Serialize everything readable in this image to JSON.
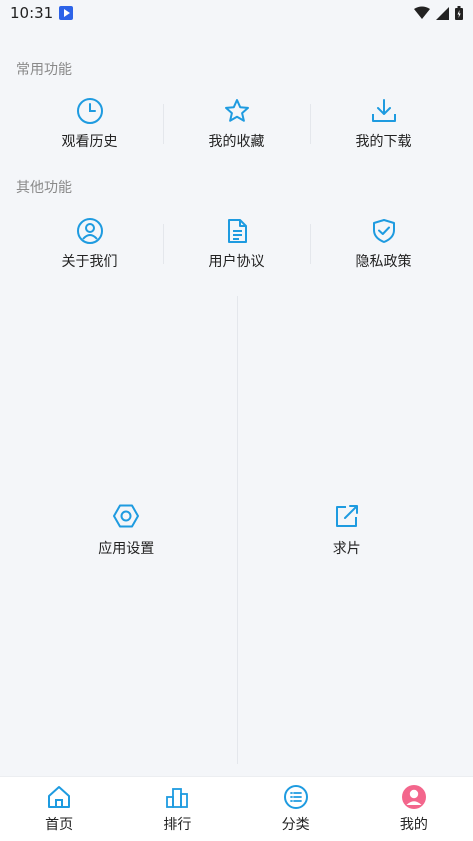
{
  "status_bar": {
    "time": "10:31",
    "icons": [
      "app-notification-icon",
      "wifi-icon",
      "signal-icon",
      "battery-icon"
    ]
  },
  "common": {
    "title": "常用功能",
    "items": [
      {
        "label": "观看历史",
        "icon": "clock-icon"
      },
      {
        "label": "我的收藏",
        "icon": "star-icon"
      },
      {
        "label": "我的下载",
        "icon": "download-icon"
      }
    ]
  },
  "other": {
    "title": "其他功能",
    "items": [
      {
        "label": "关于我们",
        "icon": "user-circle-icon"
      },
      {
        "label": "用户协议",
        "icon": "document-icon"
      },
      {
        "label": "隐私政策",
        "icon": "shield-check-icon"
      }
    ]
  },
  "tools": {
    "items": [
      {
        "label": "应用设置",
        "icon": "hexagon-settings-icon"
      },
      {
        "label": "求片",
        "icon": "external-link-icon"
      }
    ]
  },
  "tabs": [
    {
      "label": "首页",
      "icon": "home-icon"
    },
    {
      "label": "排行",
      "icon": "ranking-icon"
    },
    {
      "label": "分类",
      "icon": "category-list-icon"
    },
    {
      "label": "我的",
      "icon": "avatar-icon",
      "active": true
    }
  ],
  "colors": {
    "accent": "#1e9be0",
    "background": "#f4f6f9",
    "avatar": "#f3668c"
  }
}
